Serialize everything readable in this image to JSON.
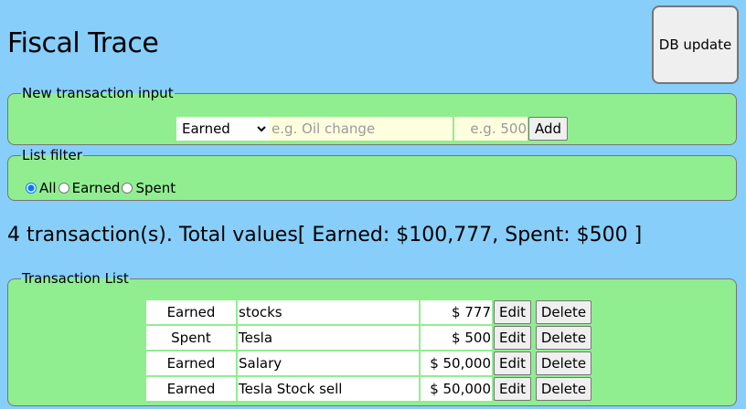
{
  "app": {
    "title": "Fiscal Trace",
    "db_update_label": "DB update"
  },
  "input_section": {
    "legend": "New transaction input",
    "type_selected": "Earned",
    "type_options": [
      "Earned"
    ],
    "description_placeholder": "e.g. Oil change",
    "description_value": "",
    "amount_placeholder": "e.g. 500",
    "amount_value": "",
    "add_label": "Add"
  },
  "filter_section": {
    "legend": "List filter",
    "options": [
      {
        "label": "All",
        "checked": true
      },
      {
        "label": "Earned",
        "checked": false
      },
      {
        "label": "Spent",
        "checked": false
      }
    ]
  },
  "summary": "4 transaction(s). Total values[ Earned: $100,777, Spent: $500 ]",
  "list_section": {
    "legend": "Transaction List",
    "edit_label": "Edit",
    "delete_label": "Delete",
    "rows": [
      {
        "type": "Earned",
        "description": "stocks",
        "amount": "$ 777"
      },
      {
        "type": "Spent",
        "description": "Tesla",
        "amount": "$ 500"
      },
      {
        "type": "Earned",
        "description": "Salary",
        "amount": "$ 50,000"
      },
      {
        "type": "Earned",
        "description": "Tesla Stock sell",
        "amount": "$ 50,000"
      }
    ]
  },
  "colors": {
    "page_background": "#87cefa",
    "section_background": "#90ee90",
    "input_background": "#ffffe0"
  }
}
